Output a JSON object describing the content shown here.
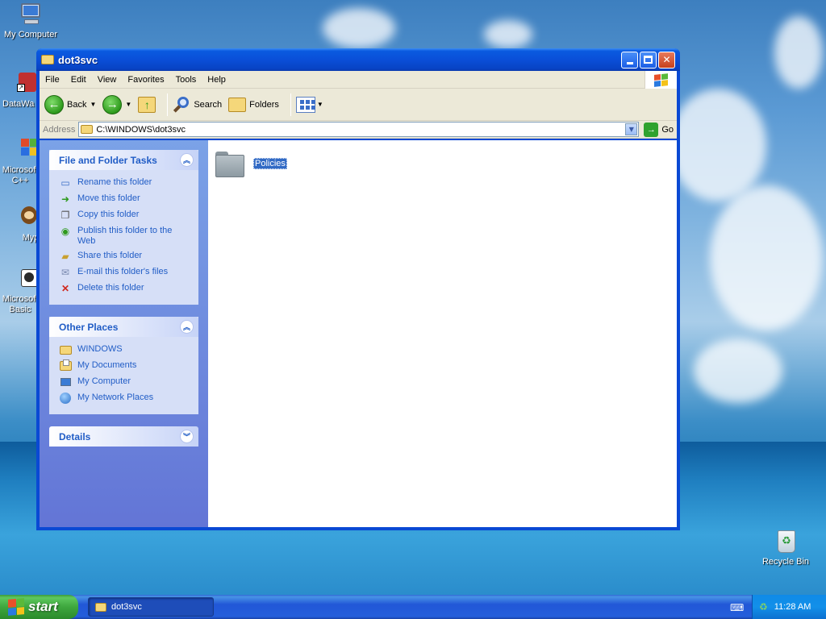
{
  "desktop": {
    "icons": [
      {
        "label": "My Computer"
      },
      {
        "label": "DataWa"
      },
      {
        "label": "Microsoft C++"
      },
      {
        "label": "Myp"
      },
      {
        "label": "Microsoft Basic"
      },
      {
        "label": "Recycle Bin"
      }
    ]
  },
  "window": {
    "title": "dot3svc",
    "menu": [
      "File",
      "Edit",
      "View",
      "Favorites",
      "Tools",
      "Help"
    ],
    "toolbar": {
      "back": "Back",
      "search": "Search",
      "folders": "Folders"
    },
    "address": {
      "label": "Address",
      "value": "C:\\WINDOWS\\dot3svc",
      "go": "Go"
    },
    "file_folder_tasks": {
      "title": "File and Folder Tasks",
      "items": [
        {
          "label": "Rename this folder",
          "icon": "rename-icon"
        },
        {
          "label": "Move this folder",
          "icon": "move-icon"
        },
        {
          "label": "Copy this folder",
          "icon": "copy-icon"
        },
        {
          "label": "Publish this folder to the Web",
          "icon": "publish-icon"
        },
        {
          "label": "Share this folder",
          "icon": "share-icon"
        },
        {
          "label": "E-mail this folder's files",
          "icon": "email-icon"
        },
        {
          "label": "Delete this folder",
          "icon": "delete-icon"
        }
      ]
    },
    "other_places": {
      "title": "Other Places",
      "items": [
        {
          "label": "WINDOWS",
          "icon": "folder-icon"
        },
        {
          "label": "My Documents",
          "icon": "my-documents-icon"
        },
        {
          "label": "My Computer",
          "icon": "my-computer-icon"
        },
        {
          "label": "My Network Places",
          "icon": "network-places-icon"
        }
      ]
    },
    "details": {
      "title": "Details"
    },
    "files": [
      {
        "name": "Policies",
        "selected": true
      }
    ]
  },
  "taskbar": {
    "start": "start",
    "task_button": "dot3svc",
    "clock": "11:28 AM"
  },
  "colors": {
    "titlebar": "#0a4fd8",
    "taskpane_link": "#215dc6",
    "selection": "#316ac5",
    "start_green": "#3ea73e"
  }
}
